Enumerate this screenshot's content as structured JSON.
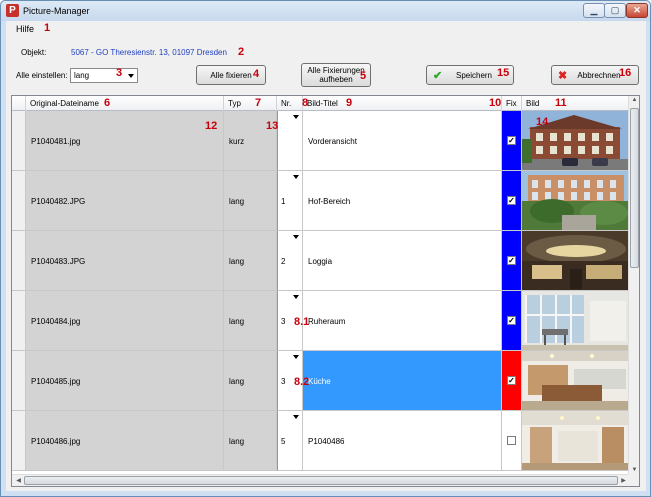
{
  "window": {
    "title": "Picture-Manager",
    "icon": "P"
  },
  "menu": {
    "help": "Hilfe"
  },
  "object": {
    "label": "Objekt:",
    "value": "5067 - GO Theresienstr. 13, 01097 Dresden"
  },
  "toolbar": {
    "set_all_label": "Alle einstellen:",
    "set_all_value": "lang",
    "fix_all": "Alle fixieren",
    "unfix_all_line1": "Alle Fixierungen",
    "unfix_all_line2": "aufheben",
    "save": "Speichern",
    "cancel": "Abbrechnen"
  },
  "columns": [
    "Original-Dateiname",
    "Typ",
    "Nr.",
    "Bild-Titel",
    "Fix",
    "Bild"
  ],
  "rows": [
    {
      "filename": "P1040481.jpg",
      "typ": "kurz",
      "nr": "",
      "title": "Vorderansicht",
      "fixed": true,
      "fix_color": "#0000ff",
      "selected": false,
      "thumb": "building"
    },
    {
      "filename": "P1040482.JPG",
      "typ": "lang",
      "nr": "1",
      "title": "Hof-Bereich",
      "fixed": true,
      "fix_color": "#0000ff",
      "selected": false,
      "thumb": "courtyard"
    },
    {
      "filename": "P1040483.JPG",
      "typ": "lang",
      "nr": "2",
      "title": "Loggia",
      "fixed": true,
      "fix_color": "#0000ff",
      "selected": false,
      "thumb": "loggia"
    },
    {
      "filename": "P1040484.jpg",
      "typ": "lang",
      "nr": "3",
      "title": "Ruheraum",
      "fixed": true,
      "fix_color": "#0000ff",
      "selected": false,
      "thumb": "restroom"
    },
    {
      "filename": "P1040485.jpg",
      "typ": "lang",
      "nr": "3",
      "title": "Küche",
      "fixed": true,
      "fix_color": "#ff0000",
      "selected": true,
      "thumb": "kitchen"
    },
    {
      "filename": "P1040486.jpg",
      "typ": "lang",
      "nr": "5",
      "title": "P1040486",
      "fixed": false,
      "fix_color": "#ffffff",
      "selected": false,
      "thumb": "hall"
    }
  ],
  "annotations": [
    "1",
    "2",
    "3",
    "4",
    "5",
    "15",
    "16",
    "6",
    "7",
    "8",
    "9",
    "10",
    "11",
    "12",
    "13",
    "14",
    "8.1",
    "8.2"
  ],
  "colors": {
    "accent": "#3399ff",
    "fix_blue": "#0000ff",
    "fix_red": "#ff0000",
    "annotation": "#c8000a",
    "object_link": "#1f3fc0"
  }
}
